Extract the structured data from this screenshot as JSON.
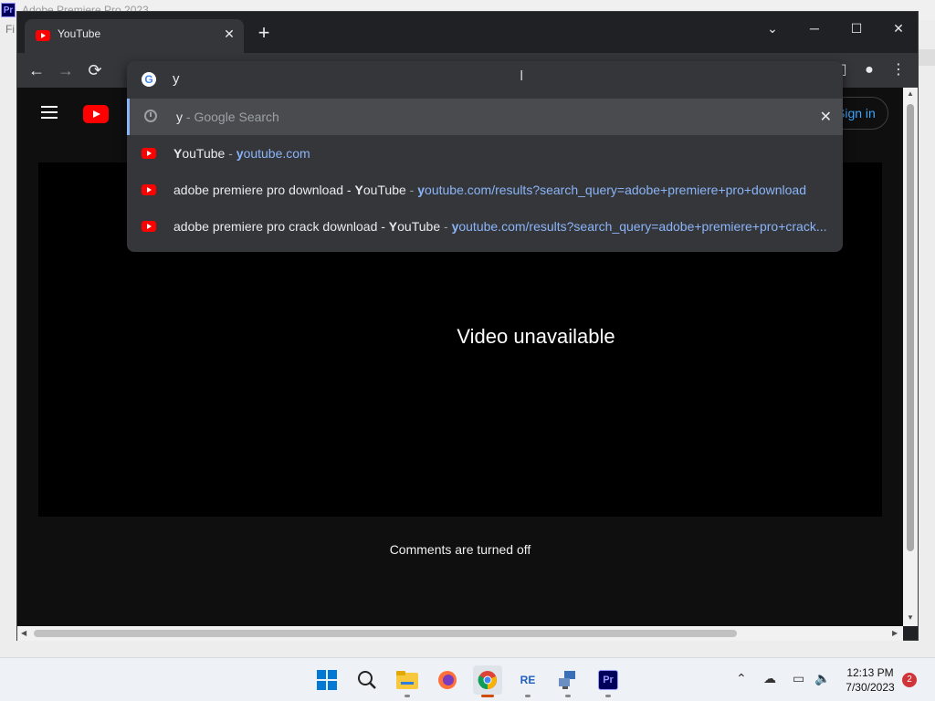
{
  "background_app": {
    "title": "Adobe Premiere Pro 2023",
    "icon_label": "Pr",
    "menu_label": "Fi"
  },
  "browser": {
    "tab": {
      "title": "YouTube"
    },
    "window_controls": {
      "minimize": "─",
      "maximize": "☐",
      "close": "✕",
      "tab_search": "⌄"
    },
    "new_tab": "+",
    "nav": {
      "back": "←",
      "forward": "→",
      "reload": "⟳"
    },
    "toolbar_right": {
      "side_panel": "◧",
      "profile": "●",
      "menu": "⋮"
    }
  },
  "omnibox": {
    "input_value": "y",
    "suggestions": [
      {
        "type": "search",
        "match": "y",
        "rest": "",
        "sep": " - ",
        "desc": "Google Search",
        "remove": "✕"
      },
      {
        "type": "site",
        "bold": "Y",
        "title": "ouTube",
        "sep": " - ",
        "url_bold": "y",
        "url": "outube.com"
      },
      {
        "type": "site",
        "title_pre": "adobe premiere pro download - ",
        "bold": "Y",
        "title": "ouTube",
        "sep": " - ",
        "url_bold": "y",
        "url": "outube.com/results?search_query=adobe+premiere+pro+download"
      },
      {
        "type": "site",
        "title_pre": "adobe premiere pro crack download - ",
        "bold": "Y",
        "title": "ouTube",
        "sep": " - ",
        "url_bold": "y",
        "url": "outube.com/results?search_query=adobe+premiere+pro+crack..."
      }
    ]
  },
  "page": {
    "sign_in": "Sign in",
    "video_message": "Video unavailable",
    "comments_message": "Comments are turned off"
  },
  "taskbar": {
    "time": "12:13 PM",
    "date": "7/30/2023",
    "notification_count": "2",
    "apps": [
      {
        "name": "start-icon"
      },
      {
        "name": "search-icon"
      },
      {
        "name": "file-explorer-icon"
      },
      {
        "name": "firefox-icon"
      },
      {
        "name": "chrome-icon"
      },
      {
        "name": "re-app-icon",
        "label": "RE"
      },
      {
        "name": "network-app-icon"
      },
      {
        "name": "premiere-icon",
        "label": "Pr"
      }
    ]
  },
  "colors": {
    "accent": "#8ab4f8",
    "youtube_red": "#ff0000",
    "sign_in_blue": "#3ea6ff",
    "dark_bg": "#0f0f0f"
  }
}
